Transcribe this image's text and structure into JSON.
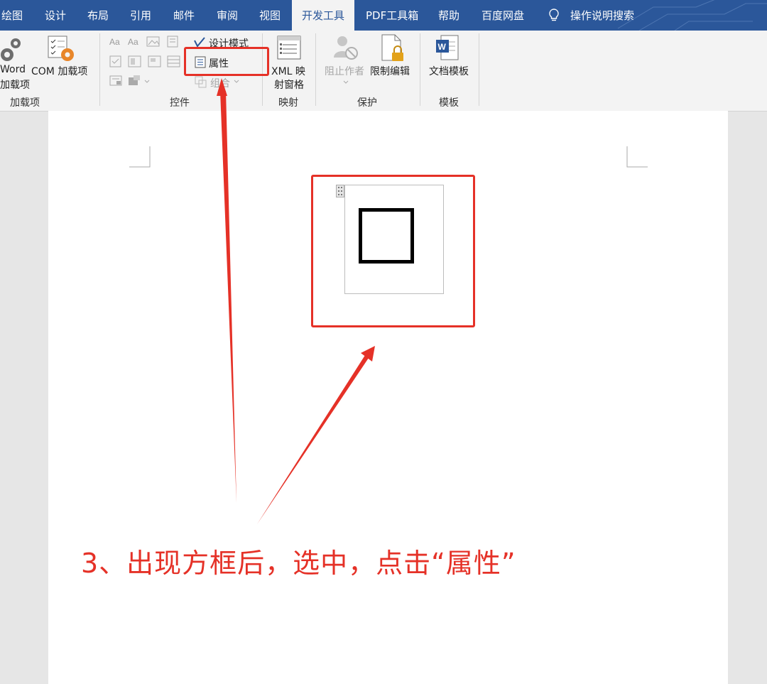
{
  "tabs": [
    "绘图",
    "设计",
    "布局",
    "引用",
    "邮件",
    "审阅",
    "视图",
    "开发工具",
    "PDF工具箱",
    "帮助",
    "百度网盘"
  ],
  "active_tab": "开发工具",
  "tell_me": {
    "icon": "lightbulb-icon",
    "text": "操作说明搜索"
  },
  "ribbon": {
    "addins": {
      "word_line1": "Word",
      "word_line2": "加载项",
      "com": "COM 加载项",
      "group": "加载项"
    },
    "controls": {
      "design_mode": "设计模式",
      "properties": "属性",
      "group_btn": "组合",
      "group": "控件"
    },
    "mapping": {
      "line1": "XML 映",
      "line2": "射窗格",
      "group": "映射"
    },
    "protect": {
      "block": "阻止作者",
      "restrict": "限制编辑",
      "group": "保护"
    },
    "templates": {
      "doc_template": "文档模板",
      "group": "模板"
    }
  },
  "annotation": {
    "caption": "3、出现方框后，选中，点击“属性”",
    "color": "#e53127"
  },
  "colors": {
    "tabbar": "#2b579a",
    "ribbon": "#f3f3f3",
    "accent": "#e53127"
  }
}
